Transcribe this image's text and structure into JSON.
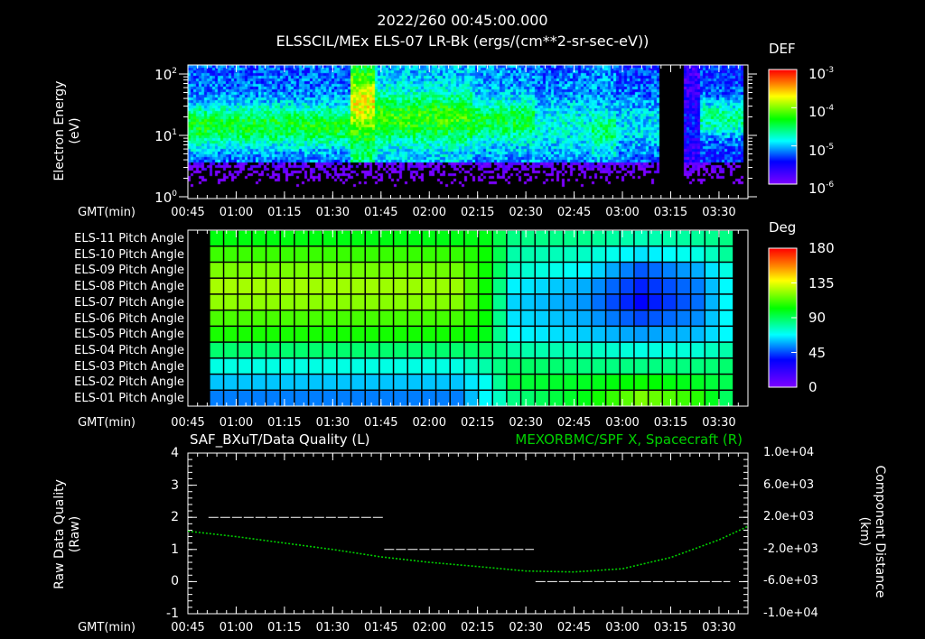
{
  "header": {
    "datetime": "2022/260 00:45:00.000",
    "subtitle": "ELSSCIL/MEx ELS-07 LR-Bk  (ergs/(cm**2-sr-sec-eV))"
  },
  "time_axis": {
    "label": "GMT(min)",
    "ticks": [
      "00:45",
      "01:00",
      "01:15",
      "01:30",
      "01:45",
      "02:00",
      "02:15",
      "02:30",
      "02:45",
      "03:00",
      "03:15",
      "03:30"
    ],
    "tick_minutes": [
      0,
      15,
      30,
      45,
      60,
      75,
      90,
      105,
      120,
      135,
      150,
      165
    ],
    "range_minutes": [
      0,
      174
    ]
  },
  "chart_data": [
    {
      "type": "heatmap",
      "name": "electron-energy-spectrogram",
      "ylabel": "Electron Energy",
      "yunit": "(eV)",
      "yscale": "log",
      "ylim": [
        1,
        135
      ],
      "yticks": [
        {
          "base": "10",
          "exp": "0",
          "value": 1
        },
        {
          "base": "10",
          "exp": "1",
          "value": 10
        },
        {
          "base": "10",
          "exp": "2",
          "value": 100
        }
      ],
      "colorbar": {
        "title": "DEF",
        "scale": "log",
        "range": [
          1e-06,
          0.001
        ],
        "ticks": [
          {
            "base": "10",
            "exp": "-3",
            "log": -3
          },
          {
            "base": "10",
            "exp": "-4",
            "log": -4
          },
          {
            "base": "10",
            "exp": "-5",
            "log": -5
          },
          {
            "base": "10",
            "exp": "-6",
            "log": -6
          }
        ]
      },
      "segments": [
        {
          "start_min": 0,
          "end_min": 50,
          "band_center_eV": 15,
          "band_peak_log_def": -4.35,
          "band_width_decades": 0.35,
          "background_log_def": -5.2
        },
        {
          "start_min": 50,
          "end_min": 58,
          "band_center_eV": 35,
          "band_peak_log_def": -3.7,
          "band_width_decades": 0.5,
          "background_log_def": -4.6
        },
        {
          "start_min": 58,
          "end_min": 88,
          "band_center_eV": 20,
          "band_peak_log_def": -4.2,
          "band_width_decades": 0.4,
          "background_log_def": -5.0
        },
        {
          "start_min": 88,
          "end_min": 107,
          "band_center_eV": 18,
          "band_peak_log_def": -4.4,
          "band_width_decades": 0.35,
          "background_log_def": -5.1
        },
        {
          "start_min": 107,
          "end_min": 125,
          "band_center_eV": 15,
          "band_peak_log_def": -4.8,
          "band_width_decades": 0.5,
          "background_log_def": -5.2
        },
        {
          "start_min": 125,
          "end_min": 133,
          "band_center_eV": 12,
          "band_peak_log_def": -4.55,
          "band_width_decades": 0.35,
          "background_log_def": -5.1
        },
        {
          "start_min": 133,
          "end_min": 146,
          "band_center_eV": 15,
          "band_peak_log_def": -4.9,
          "band_width_decades": 0.5,
          "background_log_def": -5.3
        },
        {
          "start_min": 146,
          "end_min": 154,
          "band_center_eV": 15,
          "band_peak_log_def": -6.5,
          "band_width_decades": 0.4,
          "background_log_def": -6.5
        },
        {
          "start_min": 154,
          "end_min": 159,
          "band_center_eV": 15,
          "band_peak_log_def": -5.4,
          "band_width_decades": 0.4,
          "background_log_def": -5.7
        },
        {
          "start_min": 159,
          "end_min": 172,
          "band_center_eV": 20,
          "band_peak_log_def": -4.6,
          "band_width_decades": 0.3,
          "background_log_def": -5.3
        }
      ]
    },
    {
      "type": "heatmap",
      "name": "pitch-angle-map",
      "colorbar": {
        "title": "Deg",
        "range": [
          0,
          180
        ],
        "ticks": [
          "180",
          "135",
          "90",
          "45",
          "0"
        ],
        "tick_values": [
          180,
          135,
          90,
          45,
          0
        ]
      },
      "columns": 37,
      "column_range_minutes": [
        6.7,
        169.4
      ],
      "keypoint_columns": [
        0,
        17,
        19,
        21,
        26,
        30,
        34,
        36
      ],
      "rows": [
        {
          "label": "ELS-11 Pitch Angle",
          "values": [
            101,
            100,
            100,
            85,
            84,
            78,
            82,
            85
          ]
        },
        {
          "label": "ELS-10 Pitch Angle",
          "values": [
            111,
            110,
            104,
            80,
            76,
            65,
            72,
            82
          ]
        },
        {
          "label": "ELS-09 Pitch Angle",
          "values": [
            120,
            118,
            104,
            76,
            68,
            47,
            58,
            72
          ]
        },
        {
          "label": "ELS-08 Pitch Angle",
          "values": [
            126,
            124,
            104,
            67,
            58,
            40,
            52,
            68
          ]
        },
        {
          "label": "ELS-07 Pitch Angle",
          "values": [
            123,
            121,
            104,
            63,
            55,
            36,
            50,
            68
          ]
        },
        {
          "label": "ELS-06 Pitch Angle",
          "values": [
            113,
            112,
            103,
            65,
            58,
            45,
            54,
            68
          ]
        },
        {
          "label": "ELS-05 Pitch Angle",
          "values": [
            106,
            105,
            100,
            68,
            62,
            56,
            60,
            68
          ]
        },
        {
          "label": "ELS-04 Pitch Angle",
          "values": [
            88,
            88,
            90,
            80,
            78,
            72,
            74,
            80
          ]
        },
        {
          "label": "ELS-03 Pitch Angle",
          "values": [
            72,
            72,
            80,
            90,
            86,
            85,
            86,
            88
          ]
        },
        {
          "label": "ELS-02 Pitch Angle",
          "values": [
            61,
            61,
            70,
            95,
            98,
            104,
            98,
            92
          ]
        },
        {
          "label": "ELS-01 Pitch Angle",
          "values": [
            52,
            52,
            68,
            85,
            100,
            120,
            108,
            90
          ]
        }
      ]
    },
    {
      "type": "line",
      "name": "quality-and-position",
      "left_title": "SAF_BXuT/Data Quality (L)",
      "right_title": "MEXORBMC/SPF X, Spacecraft (R)",
      "ylabel_left": "Raw Data Quality",
      "ylabel_left_unit": "(Raw)",
      "ylabel_right": "Component Distance",
      "ylabel_right_unit": "(km)",
      "ylim_left": [
        -1,
        4
      ],
      "yticks_left": [
        "4",
        "3",
        "2",
        "1",
        "0",
        "-1"
      ],
      "ylim_right": [
        -10000,
        10000
      ],
      "yticks_right": [
        "1.0e+04",
        "6.0e+03",
        "2.0e+03",
        "-2.0e+03",
        "-6.0e+03",
        "-1.0e+04"
      ],
      "series": [
        {
          "name": "Data Quality",
          "axis": "left",
          "color": "#ffffff",
          "steps": [
            {
              "start_min": 6.4,
              "end_min": 60.7,
              "value": 2
            },
            {
              "start_min": 61,
              "end_min": 107.5,
              "value": 1
            },
            {
              "start_min": 108,
              "end_min": 168.5,
              "value": 0
            }
          ]
        },
        {
          "name": "SPF X",
          "axis": "right",
          "color": "#00d000",
          "x_min": [
            0,
            15,
            30,
            45,
            60,
            75,
            90,
            105,
            120,
            135,
            150,
            165,
            174
          ],
          "y_km": [
            280,
            -400,
            -1200,
            -2000,
            -2920,
            -3600,
            -4120,
            -4680,
            -4800,
            -4400,
            -3000,
            -800,
            880
          ]
        }
      ]
    }
  ]
}
